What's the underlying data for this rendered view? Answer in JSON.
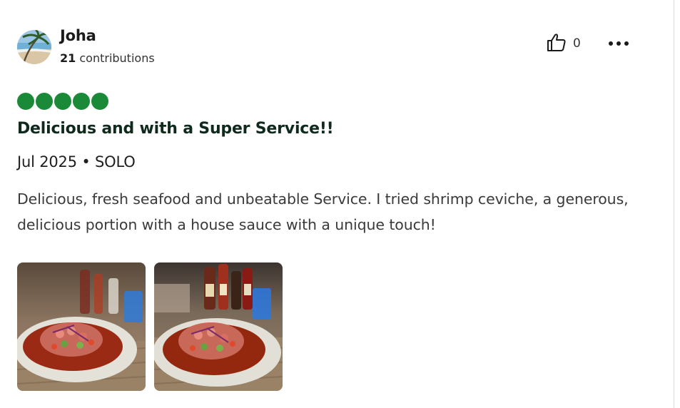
{
  "review": {
    "author": "Joha",
    "contributions_count": "21",
    "contributions_label": "contributions",
    "helpful_count": "0",
    "rating": 5,
    "title": "Delicious and with a Super Service!!",
    "meta": "Jul 2025 • SOLO",
    "text": "Delicious, fresh seafood and unbeatable Service. I tried shrimp ceviche, a generous, delicious portion with a house sauce with a unique touch!"
  },
  "icons": {
    "helpful": "thumbs-up-icon",
    "more": "more-options-icon"
  },
  "colors": {
    "rating_bubble": "#1b8a38",
    "title": "#0f2a1c",
    "divider": "#dadada"
  }
}
